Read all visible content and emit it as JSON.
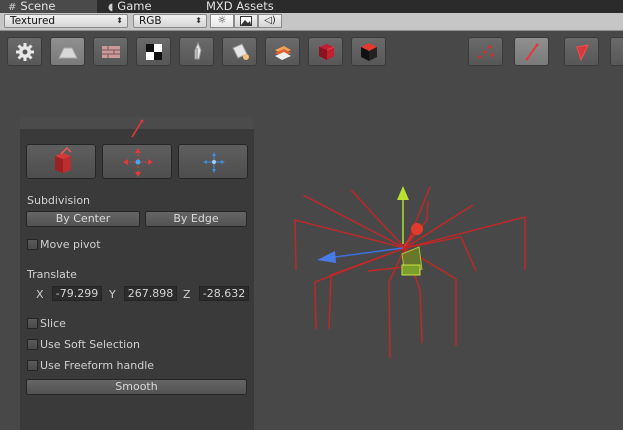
{
  "tabs": {
    "scene": "Scene",
    "game": "Game",
    "assets": "MXD Assets"
  },
  "view_toolbar": {
    "draw_mode": "Textured",
    "channel": "RGB"
  },
  "panel": {
    "subdivision_label": "Subdivision",
    "by_center": "By Center",
    "by_edge": "By Edge",
    "move_pivot": "Move pivot",
    "translate_label": "Translate",
    "x_label": "X",
    "x_value": "-79.299",
    "y_label": "Y",
    "y_value": "267.898",
    "z_label": "Z",
    "z_value": "-28.632",
    "slice": "Slice",
    "soft_selection": "Use Soft Selection",
    "freeform": "Use Freeform handle",
    "smooth": "Smooth"
  },
  "colors": {
    "accent_red": "#e03030",
    "gizmo_green": "#b8e030",
    "gizmo_blue": "#4a7ae8",
    "wire_red": "#c82828"
  }
}
